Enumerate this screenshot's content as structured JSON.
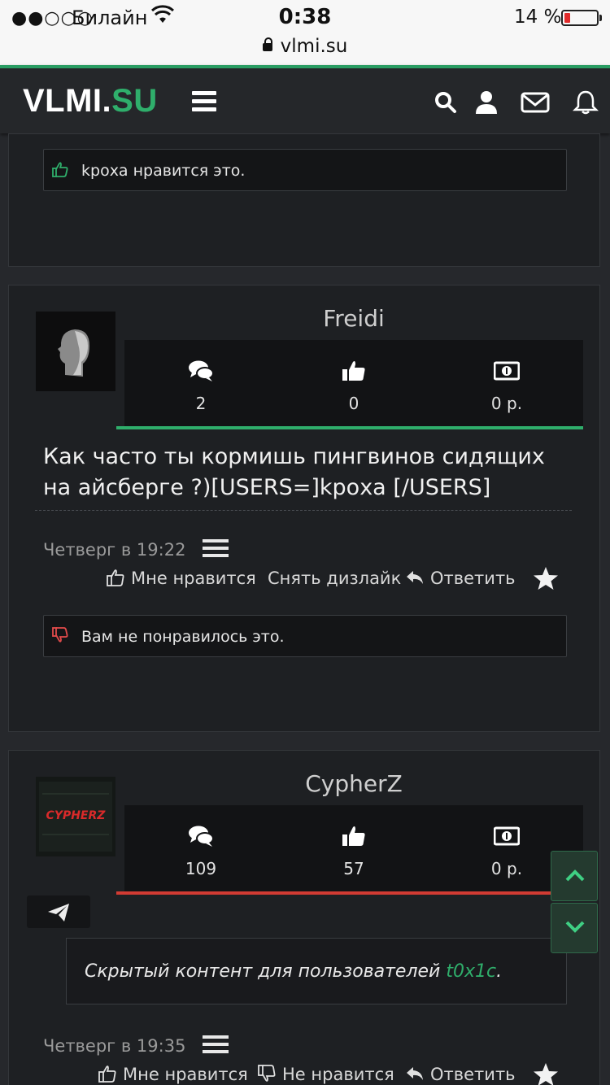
{
  "status_bar": {
    "signal": "●●○○○",
    "carrier": "Билайн",
    "time": "0:38",
    "battery": "14 %",
    "url": "vlmi.su"
  },
  "header": {
    "logo_main": "VLMI.",
    "logo_accent": "SU",
    "accent_color": "#2fae6b"
  },
  "posts": [
    {
      "notice": {
        "text": "kроха нравится это.",
        "icon": "thumbs-up-icon",
        "color": "#2fae6b"
      }
    },
    {
      "username": "Freidi",
      "stats": {
        "messages": "2",
        "likes": "0",
        "money": "0 р."
      },
      "bar_color": "#2fae6b",
      "text": "Как часто ты кормишь пингвинов сидящих на айсберге ?)[USERS=]kроха [/USERS]",
      "date": "Четверг в 19:22",
      "actions": {
        "like": "Мне нравится",
        "undislike": "Снять дизлайк",
        "reply": "Ответить"
      },
      "notice": {
        "text": "Вам не понравилось это.",
        "icon": "thumbs-down-icon",
        "color": "#e24b4b"
      }
    },
    {
      "username": "CypherZ",
      "avatar_text": "CYPHERZ",
      "stats": {
        "messages": "109",
        "likes": "57",
        "money": "0 р."
      },
      "bar_color": "#d23b33",
      "hidden_text": "Скрытый контент для пользователей ",
      "hidden_link": "t0x1c",
      "hidden_end": ".",
      "date": "Четверг в 19:35",
      "actions": {
        "like": "Мне нравится",
        "dislike": "Не нравится",
        "reply": "Ответить"
      }
    }
  ]
}
